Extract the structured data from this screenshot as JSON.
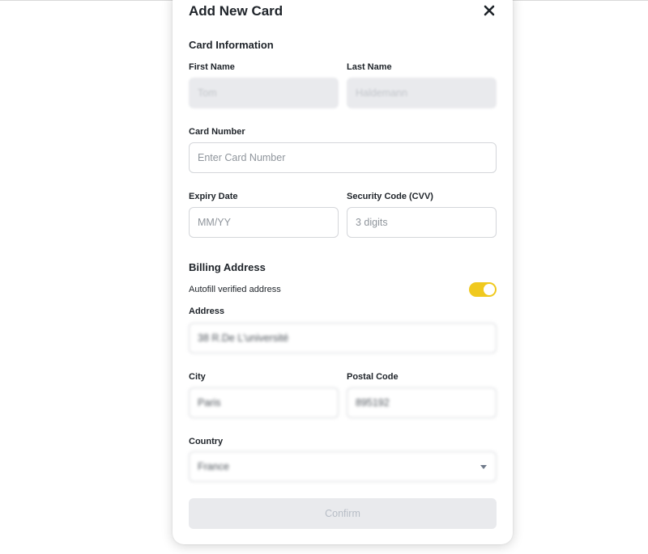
{
  "modal": {
    "title": "Add New Card",
    "close_icon": "close-icon"
  },
  "card_info": {
    "heading": "Card Information",
    "first_name": {
      "label": "First Name",
      "value": "Tom"
    },
    "last_name": {
      "label": "Last Name",
      "value": "Haldemann"
    },
    "card_number": {
      "label": "Card Number",
      "placeholder": "Enter Card Number"
    },
    "expiry": {
      "label": "Expiry Date",
      "placeholder": "MM/YY"
    },
    "cvv": {
      "label": "Security Code (CVV)",
      "placeholder": "3 digits"
    }
  },
  "billing": {
    "heading": "Billing Address",
    "autofill_label": "Autofill verified address",
    "autofill_on": true,
    "address": {
      "label": "Address",
      "value": "38 R.De L'université"
    },
    "city": {
      "label": "City",
      "value": "Paris"
    },
    "postal_code": {
      "label": "Postal Code",
      "value": "895192"
    },
    "country": {
      "label": "Country",
      "value": "France"
    }
  },
  "confirm_label": "Confirm",
  "colors": {
    "accent": "#f0c91e",
    "disabled_bg": "#e9eaed",
    "border": "#d4d6da",
    "text": "#1e2329",
    "placeholder": "#8f959c"
  }
}
